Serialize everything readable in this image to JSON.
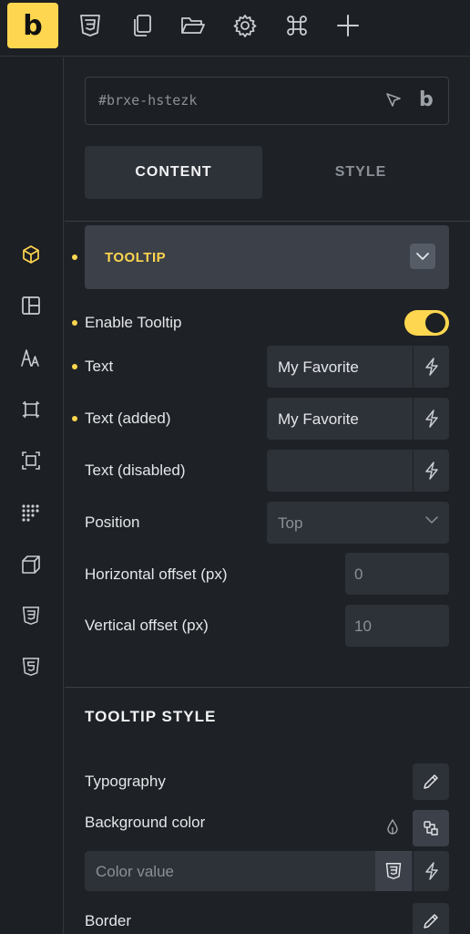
{
  "toolbar": {
    "logo_letter": "b",
    "icons": [
      "css3-icon",
      "pages-icon",
      "folder-icon",
      "settings-gear-icon",
      "command-icon",
      "add-plus-icon"
    ]
  },
  "rail": {
    "icons": [
      "cube-icon",
      "layout-icon",
      "typography-icon",
      "spacing-icon",
      "size-icon",
      "grid-dots-icon",
      "transform-icon",
      "css3-icon",
      "html5-icon"
    ],
    "active_index": 0
  },
  "panel": {
    "element_id": "#brxe-hstezk",
    "id_logo": "b",
    "tabs": {
      "content": "CONTENT",
      "style": "STYLE"
    },
    "tooltip_section": {
      "title": "TOOLTIP",
      "enable_label": "Enable Tooltip",
      "enable_on": true,
      "text_label": "Text",
      "text_value": "My Favorite",
      "text_added_label": "Text (added)",
      "text_added_value": "My Favorite",
      "text_disabled_label": "Text (disabled)",
      "text_disabled_value": "",
      "position_label": "Position",
      "position_value": "Top",
      "h_offset_label": "Horizontal offset (px)",
      "h_offset_placeholder": "0",
      "v_offset_label": "Vertical offset (px)",
      "v_offset_placeholder": "10"
    },
    "tooltip_style": {
      "title": "TOOLTIP STYLE",
      "typography_label": "Typography",
      "bg_label": "Background color",
      "color_placeholder": "Color value",
      "border_label": "Border"
    }
  },
  "colors": {
    "accent": "#ffd64f",
    "bg": "#1e2125",
    "field": "#2d3138"
  }
}
